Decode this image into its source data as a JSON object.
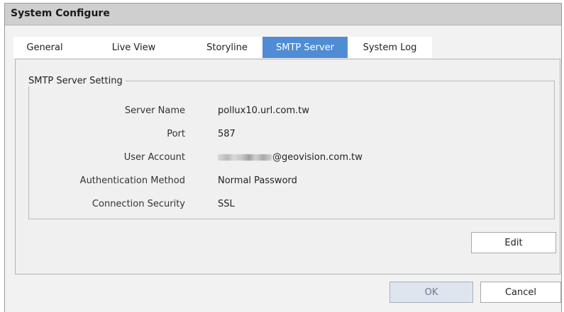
{
  "window": {
    "title": "System Configure"
  },
  "tabs": [
    {
      "label": "General",
      "active": false
    },
    {
      "label": "Live View",
      "active": false
    },
    {
      "label": "Storyline",
      "active": false
    },
    {
      "label": "SMTP Server",
      "active": true
    },
    {
      "label": "System Log",
      "active": false
    }
  ],
  "smtp": {
    "group_title": "SMTP Server Setting",
    "fields": [
      {
        "label": "Server Name",
        "value": "pollux10.url.com.tw"
      },
      {
        "label": "Port",
        "value": "587"
      },
      {
        "label": "User Account",
        "value": "@geovision.com.tw"
      },
      {
        "label": "Authentication Method",
        "value": "Normal Password"
      },
      {
        "label": "Connection Security",
        "value": "SSL"
      }
    ]
  },
  "buttons": {
    "edit": "Edit",
    "ok": "OK",
    "cancel": "Cancel"
  },
  "colors": {
    "active_tab": "#4f8cd4",
    "titlebar": "#cfcfcf",
    "ok_button": "#dfe5ee"
  }
}
